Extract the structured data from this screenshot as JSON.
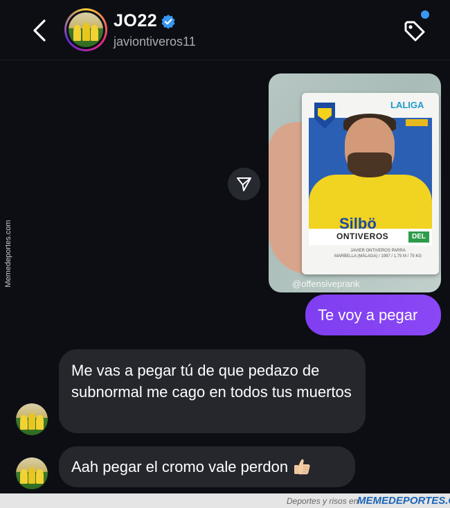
{
  "header": {
    "name": "JO22",
    "handle": "javiontiveros11",
    "icons": {
      "back": "chevron-left-icon",
      "verified": "verified-badge-icon",
      "tag": "tag-icon"
    },
    "colors": {
      "verified": "#3897f0",
      "notification_dot": "#3897f0"
    }
  },
  "side_watermark": "Memedeportes.com",
  "shared_photo": {
    "card_brand": "LALIGA",
    "card_sponsor": "Silbö",
    "player_name": "ONTIVEROS",
    "position": "DEL",
    "details_line1": "JAVIER ONTIVEROS PARRA",
    "details_line2": "MARBELLA (MÁLAGA) / 1997 / 1,75 M / 75 KG",
    "credit": "@offensiveprank"
  },
  "messages": {
    "outgoing_1": "Te voy a pegar",
    "incoming_1": "Me vas a pegar tú de que pedazo de subnormal me cago en todos tus muertos",
    "incoming_2": "Aah pegar el cromo vale perdon",
    "incoming_2_emoji": "thumbs-up-icon",
    "colors": {
      "outgoing": "#8a47f5",
      "incoming": "#25272d"
    }
  },
  "footer": {
    "caption": "Deportes y risos en",
    "brand": "MEMEDEPORTES.COM"
  }
}
